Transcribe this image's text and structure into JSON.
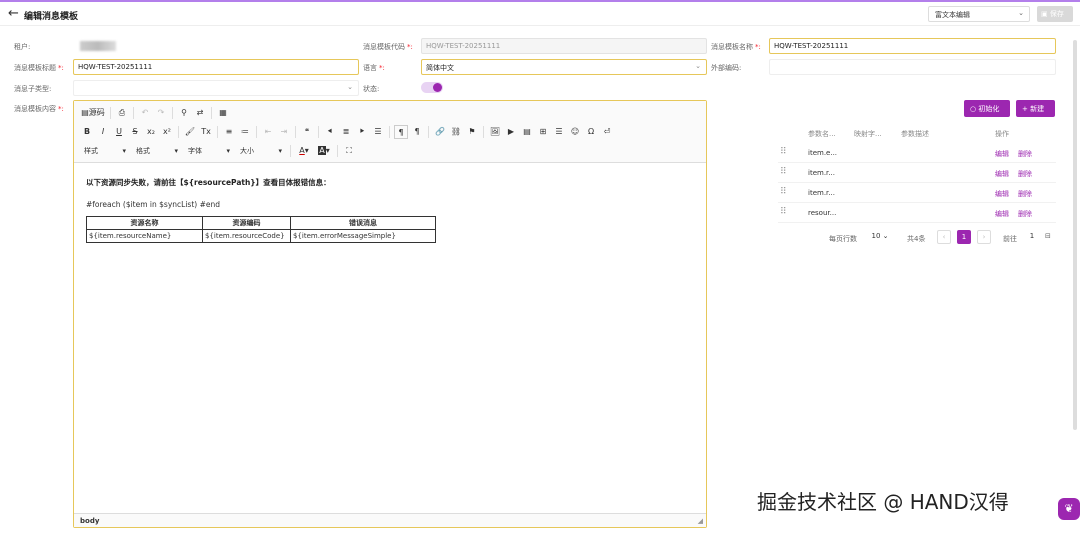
{
  "header": {
    "back_icon": "←",
    "title": "编辑消息模板",
    "mode_select": "富文本编辑",
    "save_label": "保存"
  },
  "form": {
    "tenant_label": "租户:",
    "code_label": "消息模板代码",
    "code_value": "HQW-TEST-20251111",
    "name_label": "消息模板名称",
    "name_value": "HQW-TEST-20251111",
    "title_label": "消息模板标题",
    "title_value": "HQW-TEST-20251111",
    "lang_label": "语言",
    "lang_value": "简体中文",
    "ext_label": "外部编码:",
    "subtype_label": "消息子类型:",
    "status_label": "状态:",
    "content_label": "消息模板内容"
  },
  "editor": {
    "row1": [
      "源码",
      "⎙",
      "↶",
      "↷",
      "⚲",
      "⇄",
      "▦"
    ],
    "row2": [
      "B",
      "I",
      "U",
      "S",
      "x₂",
      "x²",
      "🖌",
      "Tx",
      "≡",
      "≔",
      "⇤",
      "⇥",
      "❝",
      "⯇",
      "≣",
      "⯈",
      "☰",
      "¶",
      "¶",
      "🔗",
      "⛓",
      "⚑",
      "🖼",
      "▶",
      "▤",
      "⊞",
      "☰",
      "☺",
      "Ω",
      "⏎"
    ],
    "row3_dd": [
      "样式",
      "格式",
      "字体",
      "大小"
    ],
    "heading": "以下资源同步失败，请前往【${resourcePath}】查看目体报错信息：",
    "loop": "#foreach ($item in $syncList) #end",
    "table_headers": [
      "资源名称",
      "资源编码",
      "错误消息"
    ],
    "table_cells": [
      "${item.resourceName}",
      "${item.resourceCode}",
      "${item.errorMessageSimple}"
    ],
    "status_path": "body"
  },
  "params": {
    "init_label": "初始化",
    "new_label": "新建",
    "col_name": "参数名...",
    "col_map": "映射字...",
    "col_desc": "参数描述",
    "col_op": "操作",
    "rows": [
      "item.e...",
      "item.r...",
      "item.r...",
      "resour..."
    ],
    "edit_label": "编辑",
    "delete_label": "删除",
    "per_page_label": "每页行数",
    "per_page": "10",
    "total": "共4条",
    "current_page": "1",
    "goto_label": "前往",
    "goto_value": "1"
  },
  "watermark": "掘金技术社区 @ HAND汉得",
  "colors": {
    "accent": "#9c27b0",
    "required": "#f5222d",
    "focus_border": "#e6c75a"
  }
}
